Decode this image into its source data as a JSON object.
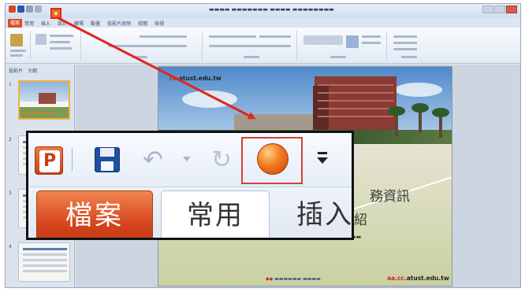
{
  "app": {
    "file_tab_label": "檔案",
    "ribbon_tabs_small": [
      "常用",
      "插入",
      "設計",
      "轉場",
      "動畫",
      "投影片放映",
      "校閱",
      "檢視"
    ],
    "panel_tabs": [
      "投影片",
      "大綱"
    ],
    "thumb_numbers": [
      "1",
      "2",
      "3",
      "4"
    ]
  },
  "slide": {
    "url_top_red": "cc.",
    "url_top_rest": "atust.edu.tw",
    "title_fragment_1": "務資訊",
    "title_fragment_2": "紹",
    "url_bottom_red": "aa.cc.",
    "url_bottom_rest": "atust.edu.tw"
  },
  "zoom": {
    "logo_letter": "P",
    "tabs": {
      "file": "檔案",
      "home": "常用",
      "insert": "插入"
    }
  },
  "icons": {
    "save": "save-icon",
    "undo": "undo-icon",
    "redo": "redo-icon",
    "record": "record-icon",
    "customize": "customize-qat-icon"
  },
  "colors": {
    "file_tab": "#d5451c",
    "annotation_red": "#e0261c",
    "record_orange": "#f27a1c"
  }
}
